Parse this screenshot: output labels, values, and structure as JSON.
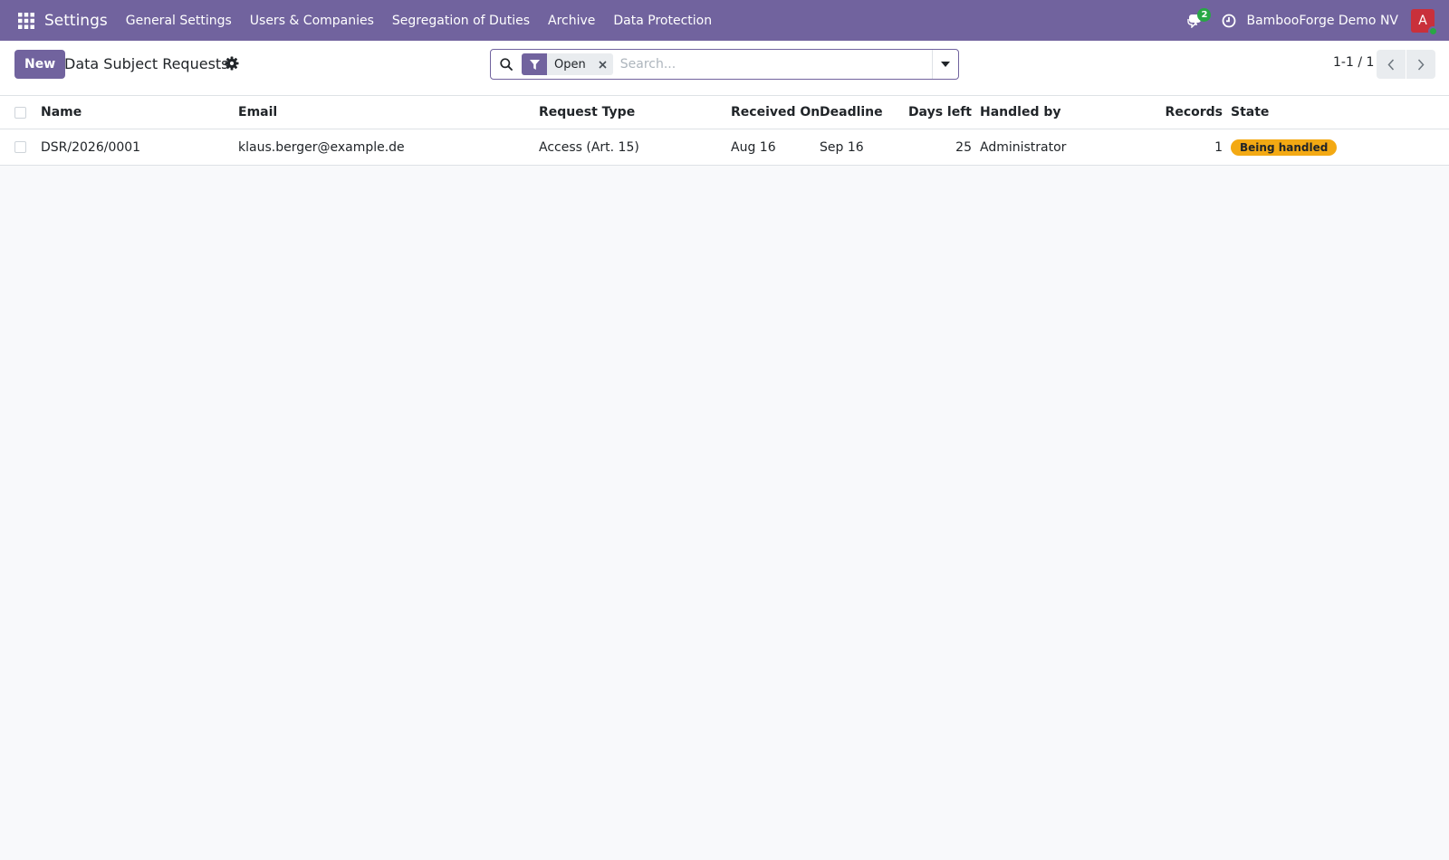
{
  "navbar": {
    "app_title": "Settings",
    "menu": [
      "General Settings",
      "Users & Companies",
      "Segregation of Duties",
      "Archive",
      "Data Protection"
    ],
    "chat_count": "2",
    "company": "BambooForge Demo NV",
    "avatar_initial": "A"
  },
  "control_panel": {
    "new_label": "New",
    "title": "Data Subject Requests",
    "search": {
      "facet_value": "Open",
      "placeholder": "Search..."
    },
    "pager": "1-1 / 1"
  },
  "list": {
    "columns": [
      "Name",
      "Email",
      "Request Type",
      "Received On",
      "Deadline",
      "Days left",
      "Handled by",
      "Records",
      "State"
    ],
    "rows": [
      {
        "name": "DSR/2026/0001",
        "email": "klaus.berger@example.de",
        "request_type": "Access (Art. 15)",
        "received_on": "Aug 16",
        "deadline": "Sep 16",
        "days_left": "25",
        "handled_by": "Administrator",
        "records": "1",
        "state": "Being handled"
      }
    ]
  },
  "colors": {
    "brand": "#71639e",
    "state_badge": "#f3a913",
    "status_online": "#28a745",
    "avatar": "#c9303b"
  }
}
